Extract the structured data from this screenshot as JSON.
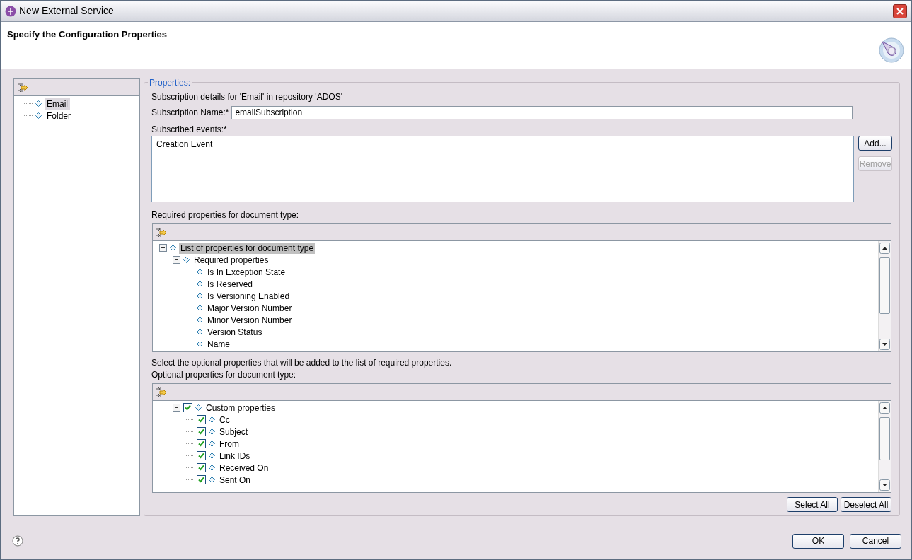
{
  "window": {
    "title": "New External Service"
  },
  "header": {
    "title": "Specify the Configuration Properties"
  },
  "sidebar": {
    "items": [
      {
        "label": "Email",
        "selected": true
      },
      {
        "label": "Folder",
        "selected": false
      }
    ]
  },
  "properties": {
    "legend": "Properties:",
    "details": "Subscription details for 'Email' in repository  'ADOS'",
    "subscription_name": {
      "label": "Subscription Name:",
      "required_mark": "*",
      "value": "emailSubscription"
    },
    "subscribed_events": {
      "label": "Subscribed events:",
      "required_mark": "*",
      "items": [
        "Creation Event"
      ]
    },
    "event_buttons": [
      {
        "label": "Add...",
        "disabled": false
      },
      {
        "label": "Remove",
        "disabled": true
      }
    ],
    "required_label": "Required properties for document type:",
    "required_tree": [
      {
        "label": "List of properties for document type",
        "expanded": true,
        "selected": true,
        "children": [
          {
            "label": "Required properties",
            "expanded": true,
            "selected": false,
            "children": [
              {
                "label": "Is In Exception State",
                "selected": false
              },
              {
                "label": "Is Reserved",
                "selected": false
              },
              {
                "label": "Is Versioning Enabled",
                "selected": false
              },
              {
                "label": "Major Version Number",
                "selected": false
              },
              {
                "label": "Minor Version Number",
                "selected": false
              },
              {
                "label": "Version Status",
                "selected": false
              },
              {
                "label": "Name",
                "selected": false
              }
            ]
          }
        ]
      }
    ],
    "optional_hint": "Select the optional properties that will be added to the list of required properties.",
    "optional_label": "Optional properties for document type:",
    "optional_tree": [
      {
        "label": "Custom properties",
        "expanded": true,
        "checked": true,
        "selected": false,
        "children": [
          {
            "label": "Cc",
            "checked": true,
            "selected": false
          },
          {
            "label": "Subject",
            "checked": true,
            "selected": false
          },
          {
            "label": "From",
            "checked": true,
            "selected": false
          },
          {
            "label": "Link IDs",
            "checked": true,
            "selected": false
          },
          {
            "label": "Received On",
            "checked": true,
            "selected": false
          },
          {
            "label": "Sent On",
            "checked": true,
            "selected": false
          }
        ]
      }
    ],
    "select_buttons": [
      "Select All",
      "Deselect All"
    ]
  },
  "footer": {
    "buttons": [
      "OK",
      "Cancel"
    ]
  }
}
